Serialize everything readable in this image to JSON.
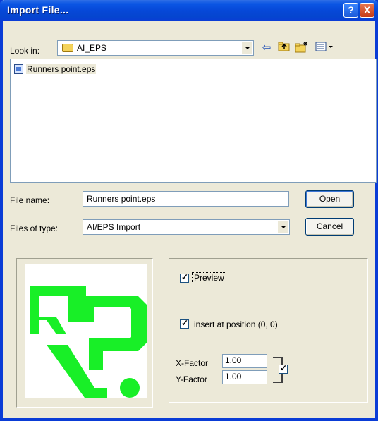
{
  "window": {
    "title": "Import File..."
  },
  "titlebar_buttons": {
    "help": "?",
    "close": "X"
  },
  "lookin": {
    "label": "Look in:",
    "value": "AI_EPS"
  },
  "toolbar": {
    "back_glyph": "⇦",
    "up_glyph": "⇧",
    "newfolder_glyph": "✱",
    "view_glyph": "▦▾"
  },
  "files": [
    {
      "name": "Runners point.eps",
      "icon": "eps-file-icon"
    }
  ],
  "filename": {
    "label": "File name:",
    "value": "Runners point.eps"
  },
  "filetype": {
    "label": "Files of type:",
    "value": "AI/EPS Import"
  },
  "buttons": {
    "open": "Open",
    "cancel": "Cancel"
  },
  "preview": {
    "checkbox_label": "Preview",
    "checked": true
  },
  "insert_position": {
    "checkbox_label": "insert at position (0, 0)",
    "checked": true
  },
  "x_factor": {
    "label": "X-Factor",
    "value": "1.00"
  },
  "y_factor": {
    "label": "Y-Factor",
    "value": "1.00"
  },
  "link_factors": {
    "checked": true
  },
  "colors": {
    "logo_green": "#18ef27",
    "title_bar": "#0648d8"
  }
}
